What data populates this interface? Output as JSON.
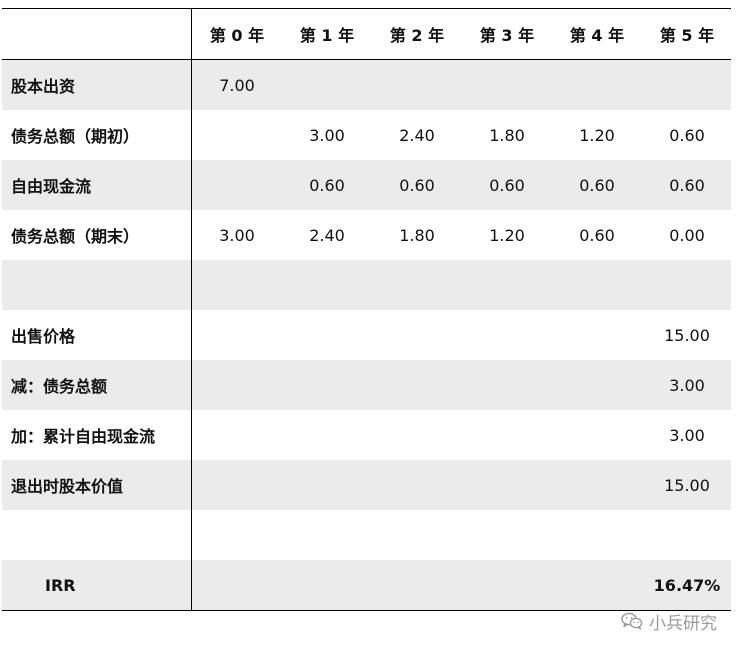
{
  "header": {
    "years": [
      "第 0 年",
      "第 1 年",
      "第 2 年",
      "第 3 年",
      "第 4 年",
      "第 5 年"
    ]
  },
  "rows": [
    {
      "label": "股本出资",
      "values": [
        "7.00",
        "",
        "",
        "",
        "",
        ""
      ]
    },
    {
      "label": "债务总额（期初）",
      "values": [
        "",
        "3.00",
        "2.40",
        "1.80",
        "1.20",
        "0.60"
      ]
    },
    {
      "label": "自由现金流",
      "values": [
        "",
        "0.60",
        "0.60",
        "0.60",
        "0.60",
        "0.60"
      ]
    },
    {
      "label": "债务总额（期末）",
      "values": [
        "3.00",
        "2.40",
        "1.80",
        "1.20",
        "0.60",
        "0.00"
      ]
    },
    {
      "label": "",
      "values": [
        "",
        "",
        "",
        "",
        "",
        ""
      ]
    },
    {
      "label": "出售价格",
      "values": [
        "",
        "",
        "",
        "",
        "",
        "15.00"
      ]
    },
    {
      "label": "减：债务总额",
      "values": [
        "",
        "",
        "",
        "",
        "",
        "3.00"
      ]
    },
    {
      "label": "加：累计自由现金流",
      "values": [
        "",
        "",
        "",
        "",
        "",
        "3.00"
      ]
    },
    {
      "label": "退出时股本价值",
      "values": [
        "",
        "",
        "",
        "",
        "",
        "15.00"
      ]
    },
    {
      "label": "",
      "values": [
        "",
        "",
        "",
        "",
        "",
        ""
      ]
    },
    {
      "label": "IRR",
      "values": [
        "",
        "",
        "",
        "",
        "",
        "16.47%"
      ]
    }
  ],
  "watermark": {
    "text": "小兵研究",
    "icon": "wechat-icon"
  },
  "colors": {
    "shade": "#ebebeb",
    "border": "#000000",
    "watermark": "#9a9a9a"
  }
}
